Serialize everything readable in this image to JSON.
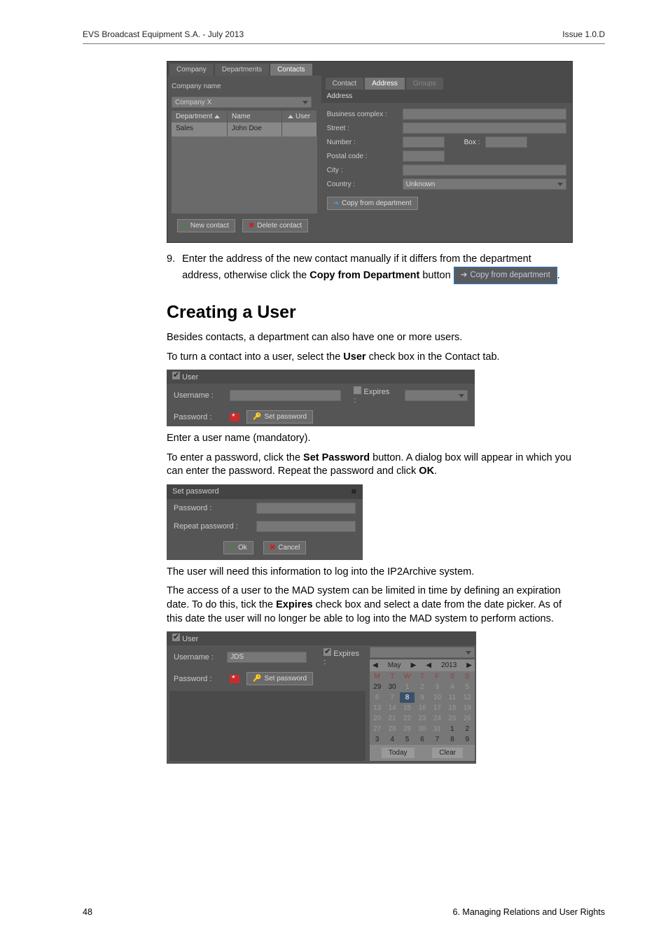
{
  "header": {
    "left": "EVS Broadcast Equipment S.A. - July 2013",
    "right": "Issue 1.0.D"
  },
  "fig1": {
    "topTabs": {
      "company": "Company",
      "departments": "Departments",
      "contacts": "Contacts"
    },
    "companyNameLabel": "Company name",
    "companyNameValue": "Company X",
    "cols": {
      "dept": "Department",
      "name": "Name",
      "user": "User"
    },
    "row": {
      "dept": "Sales",
      "name": "John Doe"
    },
    "rightTabs": {
      "contact": "Contact",
      "address": "Address",
      "groups": "Groups"
    },
    "addressHead": "Address",
    "labels": {
      "bc": "Business complex :",
      "street": "Street :",
      "number": "Number :",
      "box": "Box :",
      "postal": "Postal code :",
      "city": "City :",
      "country": "Country :"
    },
    "countryValue": "Unknown",
    "copyBtn": "Copy from department",
    "newContact": "New contact",
    "deleteContact": "Delete contact"
  },
  "step9": {
    "num": "9.",
    "line1": "Enter the address of the new contact manually if it differs from the department",
    "line2a": "address, otherwise click the ",
    "line2b": "Copy from Department",
    "line2c": " button ",
    "btn": "Copy from department",
    "dot": "."
  },
  "h2": "Creating a User",
  "p1": "Besides contacts, a department can also have one or more users.",
  "p2a": "To turn a contact into a user, select the ",
  "p2b": "User",
  "p2c": " check box in the Contact tab.",
  "userFig": {
    "head": "User",
    "username": "Username :",
    "password": "Password :",
    "expires": "Expires :",
    "setpw": "Set password"
  },
  "p3": "Enter a user name (mandatory).",
  "p4a": "To enter a password, click the ",
  "p4b": "Set Password",
  "p4c": " button. A dialog box will appear in which you can enter the password. Repeat the password and click ",
  "p4d": "OK",
  "p4e": ".",
  "setpwFig": {
    "title": "Set password",
    "pw": "Password :",
    "rpw": "Repeat password :",
    "ok": "Ok",
    "cancel": "Cancel"
  },
  "p5": "The user will need this information to log into the IP2Archive system.",
  "p6a": "The access of a user to the MAD system can be limited in time by defining an expiration date. To do this, tick the ",
  "p6b": "Expires",
  "p6c": " check box and select a date from the date picker. As of this date the user will no longer be able to log into the MAD system to perform actions.",
  "calFig": {
    "head": "User",
    "username": "Username :",
    "usernameVal": "JDS",
    "password": "Password :",
    "expires": "Expires :",
    "setpw": "Set password",
    "month": "May",
    "year": "2013",
    "dow": [
      "M",
      "T",
      "W",
      "T",
      "F",
      "S",
      "S"
    ],
    "w1": [
      "29",
      "30",
      "1",
      "2",
      "3",
      "4",
      "5"
    ],
    "w2": [
      "6",
      "7",
      "8",
      "9",
      "10",
      "11",
      "12"
    ],
    "w3": [
      "13",
      "14",
      "15",
      "16",
      "17",
      "18",
      "19"
    ],
    "w4": [
      "20",
      "21",
      "22",
      "23",
      "24",
      "25",
      "26"
    ],
    "w5": [
      "27",
      "28",
      "29",
      "30",
      "31",
      "1",
      "2"
    ],
    "w6": [
      "3",
      "4",
      "5",
      "6",
      "7",
      "8",
      "9"
    ],
    "today": "Today",
    "clear": "Clear",
    "selected": "8"
  },
  "footer": {
    "page": "48",
    "section": "6. Managing Relations and User Rights"
  }
}
